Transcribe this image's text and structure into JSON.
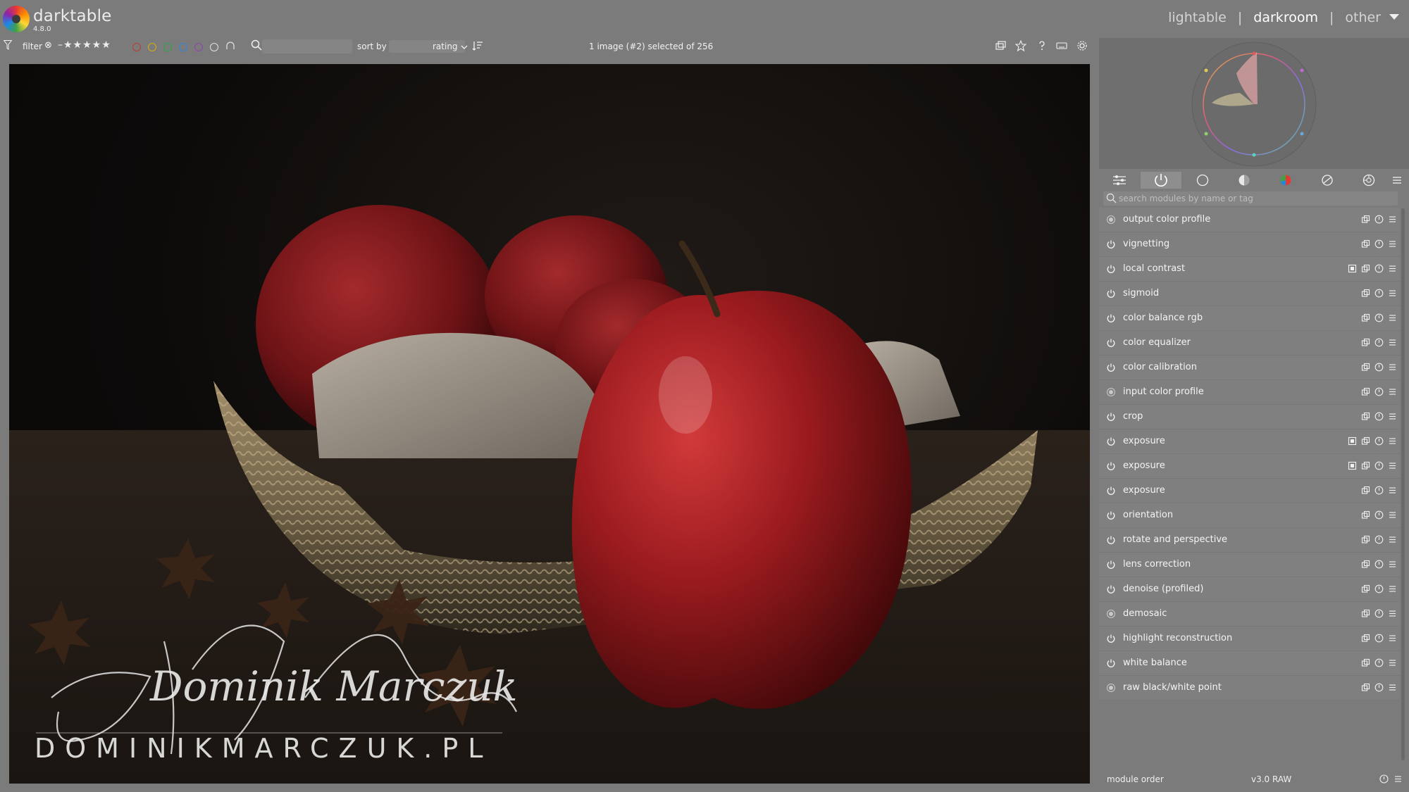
{
  "app": {
    "name": "darktable",
    "version": "4.8.0"
  },
  "views": {
    "lighttable": "lightable",
    "darkroom": "darkroom",
    "other": "other",
    "separator": "|"
  },
  "filterbar": {
    "filter_label": "filter",
    "rating_clear": "⊗",
    "rating_stars": "–★★★★★",
    "color_labels": [
      "#c0392b",
      "#d4ac0d",
      "#28a745",
      "#2e86de",
      "#8e44ad"
    ],
    "sort_label": "sort by",
    "sort_value": "rating",
    "selection_info": "1 image (#2) selected of 256"
  },
  "photo": {
    "watermark_signature": "Dominik Marczuk",
    "watermark_url": "DOMINIKMARCZUK.PL"
  },
  "module_search_placeholder": "search modules by name or tag",
  "modules": [
    {
      "name": "output color profile",
      "power": "dot",
      "mask": false
    },
    {
      "name": "vignetting",
      "power": "power",
      "mask": false
    },
    {
      "name": "local contrast",
      "power": "power",
      "mask": true
    },
    {
      "name": "sigmoid",
      "power": "power",
      "mask": false
    },
    {
      "name": "color balance rgb",
      "power": "power",
      "mask": false
    },
    {
      "name": "color equalizer",
      "power": "power",
      "mask": false
    },
    {
      "name": "color calibration",
      "power": "power",
      "mask": false
    },
    {
      "name": "input color profile",
      "power": "dot",
      "mask": false
    },
    {
      "name": "crop",
      "power": "power",
      "mask": false
    },
    {
      "name": "exposure",
      "power": "power",
      "mask": true
    },
    {
      "name": "exposure",
      "power": "power",
      "mask": true
    },
    {
      "name": "exposure",
      "power": "power",
      "mask": false
    },
    {
      "name": "orientation",
      "power": "power",
      "mask": false
    },
    {
      "name": "rotate and perspective",
      "power": "power",
      "mask": false
    },
    {
      "name": "lens correction",
      "power": "power",
      "mask": false
    },
    {
      "name": "denoise (profiled)",
      "power": "power",
      "mask": false
    },
    {
      "name": "demosaic",
      "power": "dot",
      "mask": false
    },
    {
      "name": "highlight reconstruction",
      "power": "power",
      "mask": false
    },
    {
      "name": "white balance",
      "power": "power",
      "mask": false
    },
    {
      "name": "raw black/white point",
      "power": "dot",
      "mask": false
    }
  ],
  "module_order": {
    "label": "module order",
    "value": "v3.0 RAW"
  }
}
